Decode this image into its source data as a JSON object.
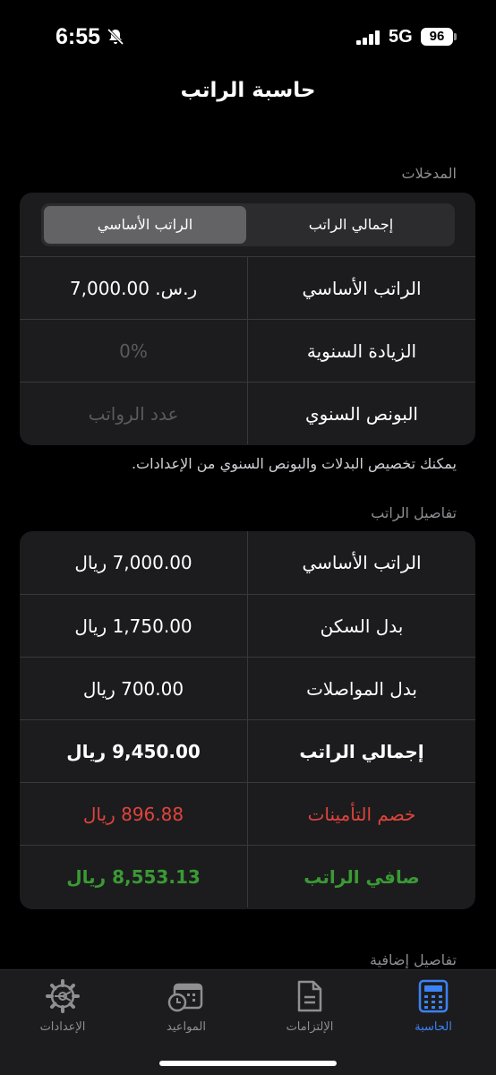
{
  "status": {
    "time": "6:55",
    "network": "5G",
    "battery": "96"
  },
  "title": "حاسبة الراتب",
  "inputs": {
    "section_label": "المدخلات",
    "segments": {
      "active": "الراتب الأساسي",
      "inactive": "إجمالي الراتب"
    },
    "rows": [
      {
        "label": "الراتب الأساسي",
        "value": "ر.س. 7,000.00"
      },
      {
        "label": "الزيادة السنوية",
        "value": "0%"
      },
      {
        "label": "البونص السنوي",
        "value": "عدد الرواتب"
      }
    ],
    "note": "يمكنك تخصيص البدلات والبونص السنوي من الإعدادات."
  },
  "details": {
    "section_label": "تفاصيل الراتب",
    "rows": [
      {
        "label": "الراتب الأساسي",
        "value": "7,000.00 ريال"
      },
      {
        "label": "بدل السكن",
        "value": "1,750.00 ريال"
      },
      {
        "label": "بدل المواصلات",
        "value": "700.00 ريال"
      },
      {
        "label": "إجمالي الراتب",
        "value": "9,450.00 ريال"
      },
      {
        "label": "خصم التأمينات",
        "value": "896.88 ريال"
      },
      {
        "label": "صافي الراتب",
        "value": "8,553.13 ريال"
      }
    ]
  },
  "extra": {
    "section_label": "تفاصيل إضافية"
  },
  "tabbar": {
    "tabs": [
      {
        "label": "الحاسبة",
        "icon": "calculator-icon",
        "active": true
      },
      {
        "label": "الإلتزامات",
        "icon": "document-icon",
        "active": false
      },
      {
        "label": "المواعيد",
        "icon": "calendar-clock-icon",
        "active": false
      },
      {
        "label": "الإعدادات",
        "icon": "gear-icon",
        "active": false
      }
    ]
  },
  "colors": {
    "accent": "#3b82f6",
    "deduction": "#e0443c",
    "net": "#3a9a34"
  }
}
